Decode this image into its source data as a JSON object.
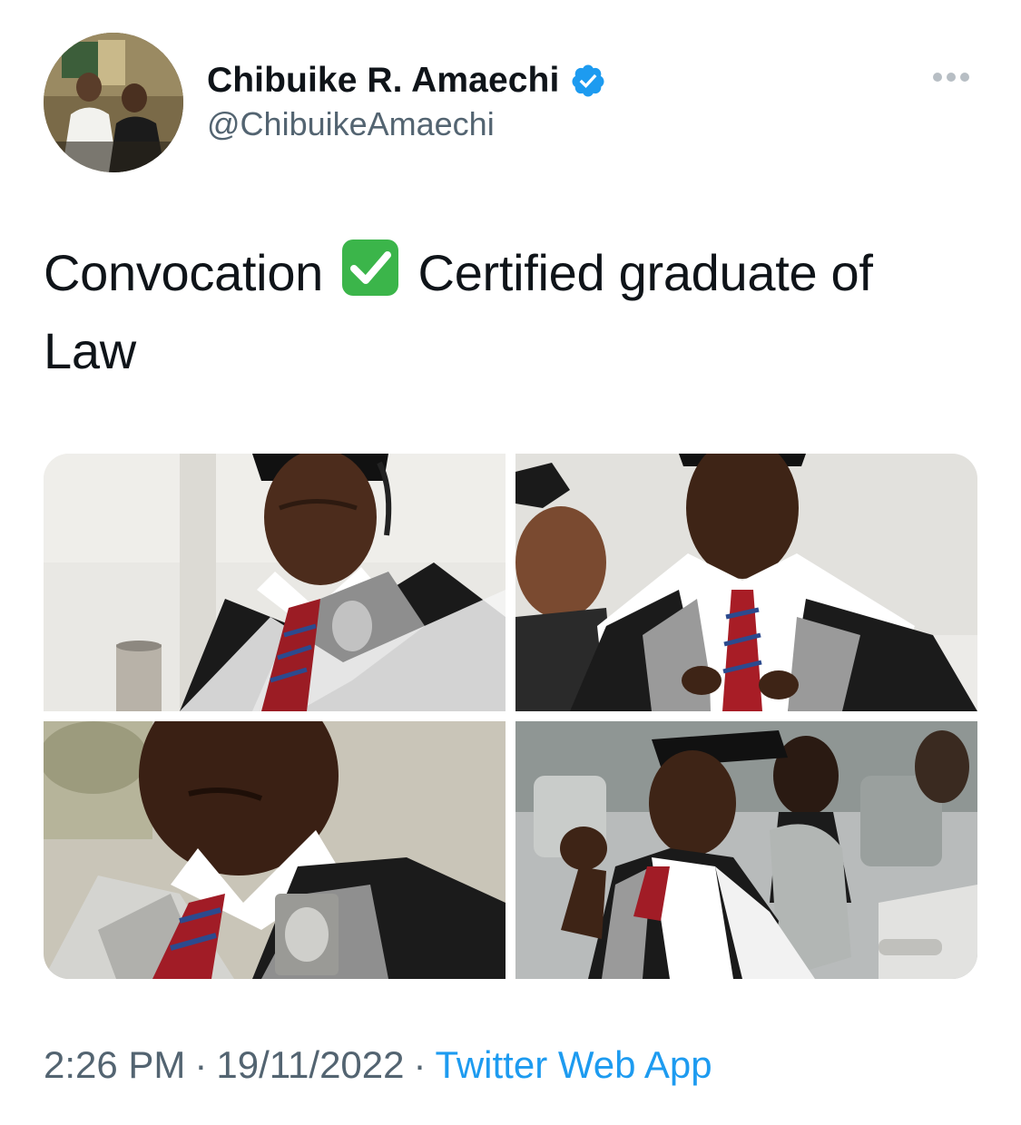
{
  "author": {
    "display_name": "Chibuike R. Amaechi",
    "handle": "@ChibuikeAmaechi",
    "verified": true
  },
  "tweet": {
    "text_before": "Convocation",
    "text_after": "Certified graduate of Law",
    "emoji": "white-heavy-check-mark"
  },
  "media": {
    "count": 4
  },
  "meta": {
    "time": "2:26 PM",
    "date": "19/11/2022",
    "separator": "·",
    "source": "Twitter Web App"
  },
  "colors": {
    "text_primary": "#0f1419",
    "text_secondary": "#536471",
    "accent": "#1d9bf0",
    "check_green": "#3bb54a"
  },
  "icons": {
    "verified": "verified-badge-icon",
    "more": "more-options-icon"
  }
}
